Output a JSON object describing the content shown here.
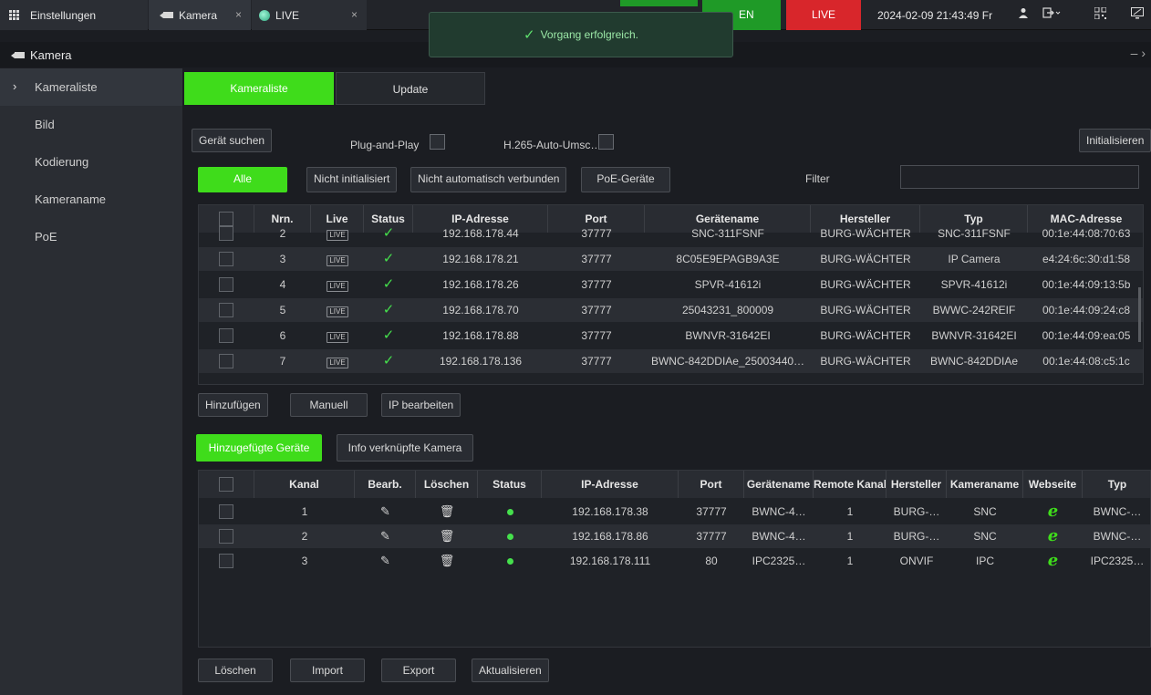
{
  "topbar": {
    "settings_label": "Einstellungen",
    "camera_tab_label": "Kamera",
    "live_tab_label": "LIVE",
    "close_glyph": "×",
    "green_badge_text": "EN",
    "live_badge": "LIVE",
    "datetime": "2024-02-09 21:43:49 Fr",
    "colors": {
      "green": "#1f9a27",
      "red": "#d8262b"
    }
  },
  "toast": {
    "message": "Vorgang erfolgreich."
  },
  "window": {
    "title": "Kamera"
  },
  "sidebar": {
    "items": [
      {
        "label": "Kameraliste",
        "active": true
      },
      {
        "label": "Bild"
      },
      {
        "label": "Kodierung"
      },
      {
        "label": "Kameraname"
      },
      {
        "label": "PoE"
      }
    ]
  },
  "tabs": {
    "kameraliste": "Kameraliste",
    "update": "Update"
  },
  "search": {
    "search_button": "Gerät suchen",
    "plug_and_play": "Plug-and-Play",
    "h265_auto": "H.265-Auto-Umsc…",
    "initialize_button": "Initialisieren",
    "filter_label": "Filter",
    "filter_value": ""
  },
  "filters": {
    "all": "Alle",
    "not_initialized": "Nicht initialisiert",
    "not_auto_connected": "Nicht automatisch verbunden",
    "poe_devices": "PoE-Geräte"
  },
  "found_table": {
    "headers": [
      "Nrn.",
      "Live",
      "Status",
      "IP-Adresse",
      "Port",
      "Gerätename",
      "Hersteller",
      "Typ",
      "MAC-Adresse"
    ],
    "live_tag": "LIVE",
    "status_glyph": "✓",
    "rows": [
      {
        "nr": "2",
        "ip": "192.168.178.44",
        "port": "37777",
        "name": "SNC-311FSNF",
        "vendor": "BURG-WÄCHTER",
        "type": "SNC-311FSNF",
        "mac": "00:1e:44:08:70:63"
      },
      {
        "nr": "3",
        "ip": "192.168.178.21",
        "port": "37777",
        "name": "8C05E9EPAGB9A3E",
        "vendor": "BURG-WÄCHTER",
        "type": "IP Camera",
        "mac": "e4:24:6c:30:d1:58"
      },
      {
        "nr": "4",
        "ip": "192.168.178.26",
        "port": "37777",
        "name": "SPVR-41612i",
        "vendor": "BURG-WÄCHTER",
        "type": "SPVR-41612i",
        "mac": "00:1e:44:09:13:5b"
      },
      {
        "nr": "5",
        "ip": "192.168.178.70",
        "port": "37777",
        "name": "25043231_800009",
        "vendor": "BURG-WÄCHTER",
        "type": "BWWC-242REIF",
        "mac": "00:1e:44:09:24:c8"
      },
      {
        "nr": "6",
        "ip": "192.168.178.88",
        "port": "37777",
        "name": "BWNVR-31642EI",
        "vendor": "BURG-WÄCHTER",
        "type": "BWNVR-31642EI",
        "mac": "00:1e:44:09:ea:05"
      },
      {
        "nr": "7",
        "ip": "192.168.178.136",
        "port": "37777",
        "name": "BWNC-842DDIAe_25003440…",
        "vendor": "BURG-WÄCHTER",
        "type": "BWNC-842DDIAe",
        "mac": "00:1e:44:08:c5:1c"
      }
    ]
  },
  "found_actions": {
    "add": "Hinzufügen",
    "manual": "Manuell",
    "edit_ip": "IP bearbeiten"
  },
  "added_tabs": {
    "added_devices": "Hinzugefügte Geräte",
    "linked_camera_info": "Info verknüpfte Kamera"
  },
  "added_table": {
    "headers": [
      "Kanal",
      "Bearb.",
      "Löschen",
      "Status",
      "IP-Adresse",
      "Port",
      "Gerätename",
      "Remote Kanal",
      "Hersteller",
      "Kameraname",
      "Webseite",
      "Typ"
    ],
    "icons": {
      "edit": "pencil-icon",
      "delete": "trash-icon",
      "status": "status-dot",
      "web": "ie-icon"
    },
    "pencil_glyph": "✎",
    "trash_glyph": "🗑",
    "web_glyph": "e",
    "rows": [
      {
        "channel": "1",
        "ip": "192.168.178.38",
        "port": "37777",
        "name": "BWNC-4…",
        "remote": "1",
        "vendor": "BURG-…",
        "cam": "SNC",
        "type": "BWNC-…"
      },
      {
        "channel": "2",
        "ip": "192.168.178.86",
        "port": "37777",
        "name": "BWNC-4…",
        "remote": "1",
        "vendor": "BURG-…",
        "cam": "SNC",
        "type": "BWNC-…"
      },
      {
        "channel": "3",
        "ip": "192.168.178.111",
        "port": "80",
        "name": "IPC2325…",
        "remote": "1",
        "vendor": "ONVIF",
        "cam": "IPC",
        "type": "IPC2325…"
      }
    ]
  },
  "bottom_actions": {
    "delete": "Löschen",
    "import": "Import",
    "export": "Export",
    "refresh": "Aktualisieren"
  }
}
